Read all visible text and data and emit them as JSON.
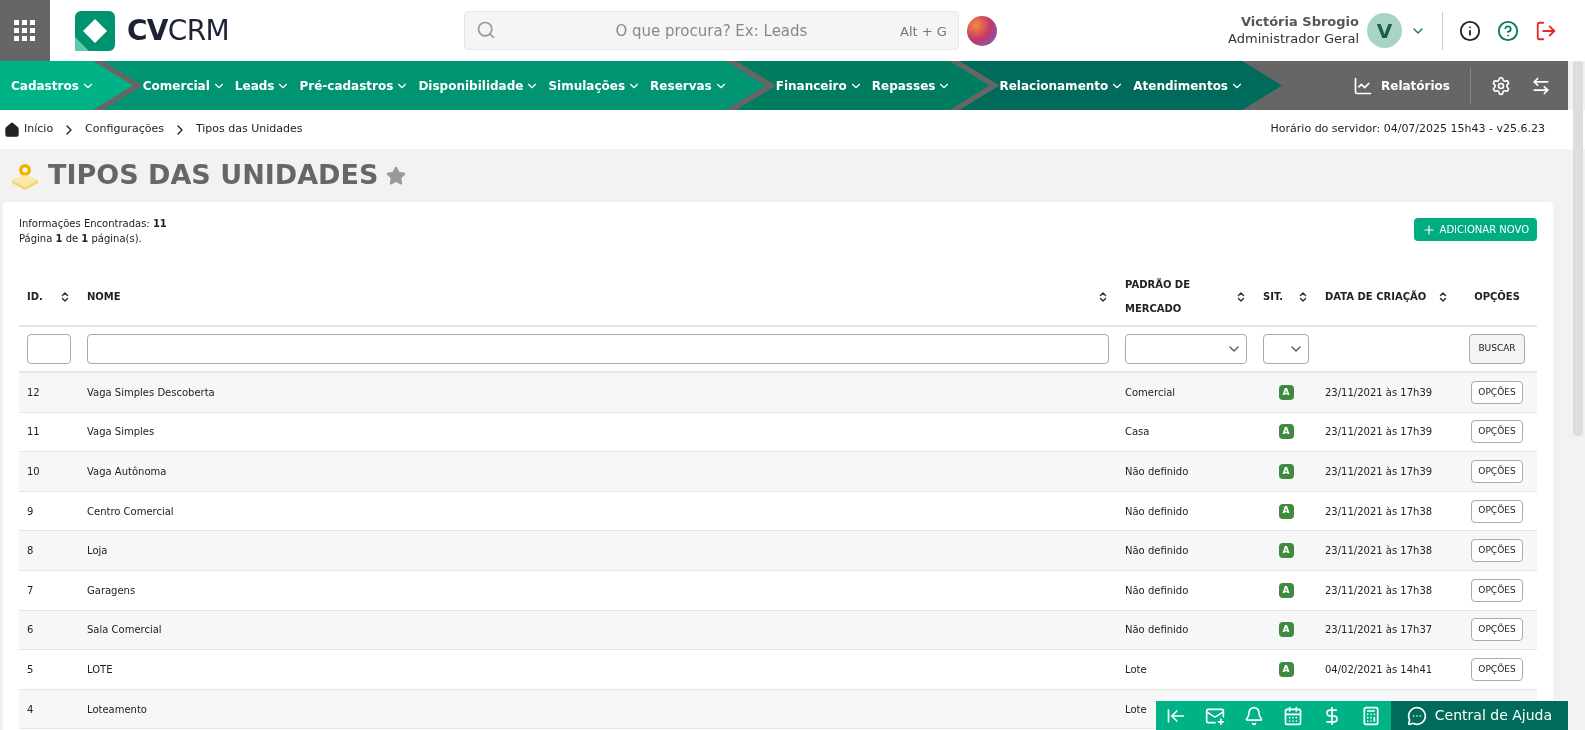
{
  "header": {
    "logo": "**CV**CRM",
    "search": {
      "placeholder": "O que procura? Ex: Leads",
      "shortcut": "Alt + G"
    },
    "user": {
      "name": "Victória Sbrogio",
      "role": "Administrador Geral",
      "initial": "V"
    }
  },
  "nav": {
    "groups": [
      {
        "items": [
          "Cadastros"
        ]
      },
      {
        "items": [
          "Comercial",
          "Leads",
          "Pré-cadastros",
          "Disponibilidade",
          "Simulações",
          "Reservas"
        ]
      },
      {
        "items": [
          "Financeiro",
          "Repasses"
        ]
      },
      {
        "items": [
          "Relacionamento",
          "Atendimentos"
        ]
      }
    ],
    "reports": "Relatórios"
  },
  "breadcrumb": {
    "items": [
      "Início",
      "Configurações",
      "Tipos das Unidades"
    ],
    "server_time": "Horário do servidor: 04/07/2025 15h43 - v25.6.23"
  },
  "page_title": "TIPOS DAS UNIDADES",
  "summary": [
    "Informações Encontradas: **11**",
    "Página **1** de **1** página(s)."
  ],
  "add_button": "ADICIONAR NOVO",
  "table": {
    "columns": [
      {
        "label": "ID.",
        "sortable": true
      },
      {
        "label": "NOME",
        "sortable": true
      },
      {
        "label": "PADRÃO DE MERCADO",
        "sortable": true
      },
      {
        "label": "SIT.",
        "sortable": true
      },
      {
        "label": "DATA DE CRIAÇÃO",
        "sortable": true
      },
      {
        "label": "OPÇÕES",
        "sortable": false
      }
    ],
    "search_button": "BUSCAR",
    "rows": [
      {
        "id": "12",
        "name": "Vaga Simples Descoberta",
        "market": "Comercial",
        "status": "A",
        "created": "23/11/2021 às 17h39",
        "action": "OPÇÕES"
      },
      {
        "id": "11",
        "name": "Vaga Simples",
        "market": "Casa",
        "status": "A",
        "created": "23/11/2021 às 17h39",
        "action": "OPÇÕES"
      },
      {
        "id": "10",
        "name": "Vaga Autônoma",
        "market": "Não definido",
        "status": "A",
        "created": "23/11/2021 às 17h39",
        "action": "OPÇÕES"
      },
      {
        "id": "9",
        "name": "Centro Comercial",
        "market": "Não definido",
        "status": "A",
        "created": "23/11/2021 às 17h38",
        "action": "OPÇÕES"
      },
      {
        "id": "8",
        "name": "Loja",
        "market": "Não definido",
        "status": "A",
        "created": "23/11/2021 às 17h38",
        "action": "OPÇÕES"
      },
      {
        "id": "7",
        "name": "Garagens",
        "market": "Não definido",
        "status": "A",
        "created": "23/11/2021 às 17h38",
        "action": "OPÇÕES"
      },
      {
        "id": "6",
        "name": "Sala Comercial",
        "market": "Não definido",
        "status": "A",
        "created": "23/11/2021 às 17h37",
        "action": "OPÇÕES"
      },
      {
        "id": "5",
        "name": "LOTE",
        "market": "Lote",
        "status": "A",
        "created": "04/02/2021 às 14h41",
        "action": "OPÇÕES"
      },
      {
        "id": "4",
        "name": "Loteamento",
        "market": "Lote"
      }
    ]
  },
  "help_bar": {
    "label": "Central de Ajuda"
  }
}
